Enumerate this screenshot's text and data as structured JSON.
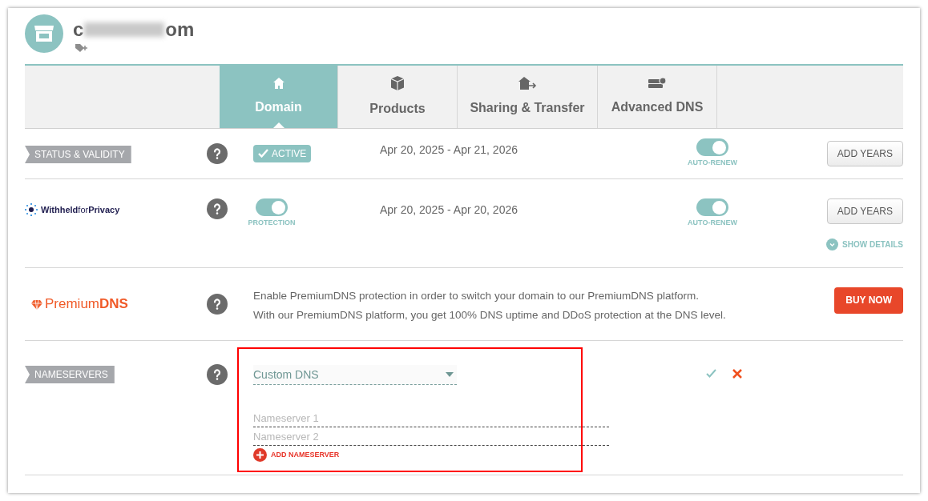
{
  "header": {
    "domain_start": "c",
    "domain_end": "om"
  },
  "tabs": [
    {
      "label": "Domain",
      "selected": true
    },
    {
      "label": "Products",
      "selected": false
    },
    {
      "label": "Sharing & Transfer",
      "selected": false
    },
    {
      "label": "Advanced DNS",
      "selected": false
    }
  ],
  "status": {
    "label": "STATUS & VALIDITY",
    "badge": "ACTIVE",
    "dates": "Apr 20, 2025 - Apr 21, 2026",
    "auto_renew": {
      "label": "AUTO-RENEW",
      "on": true
    },
    "button": "ADD YEARS"
  },
  "privacy": {
    "logo": "**Withheld**for**Privacy**",
    "protection": {
      "label": "PROTECTION",
      "on": true
    },
    "dates": "Apr 20, 2025 - Apr 20, 2026",
    "auto_renew": {
      "label": "AUTO-RENEW",
      "on": true
    },
    "button": "ADD YEARS",
    "show_details": "SHOW DETAILS"
  },
  "premium": {
    "logo": "Premium**DNS**",
    "description": [
      "Enable PremiumDNS protection in order to switch your domain to our PremiumDNS platform.",
      "With our PremiumDNS platform, you get 100% DNS uptime and DDoS protection at the DNS level."
    ],
    "button": "BUY NOW"
  },
  "nameservers": {
    "label": "NAMESERVERS",
    "select": "Custom DNS",
    "fields": [
      {
        "placeholder": "Nameserver 1"
      },
      {
        "placeholder": "Nameserver 2"
      }
    ],
    "add": "ADD NAMESERVER"
  }
}
